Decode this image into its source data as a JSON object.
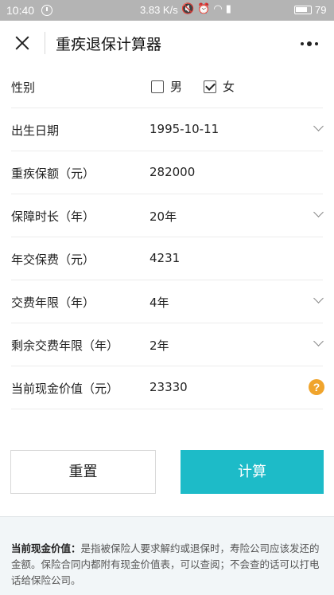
{
  "status_bar": {
    "time": "10:40",
    "speed": "3.83 K/s",
    "icons": [
      "mute-icon",
      "alarm-icon",
      "wifi-icon",
      "signal-icon"
    ],
    "battery": "79"
  },
  "nav": {
    "title": "重疾退保计算器"
  },
  "form": {
    "gender": {
      "label": "性别",
      "options": [
        {
          "label": "男",
          "checked": false
        },
        {
          "label": "女",
          "checked": true
        }
      ]
    },
    "birth_date": {
      "label": "出生日期",
      "value": "1995-10-11"
    },
    "coverage": {
      "label": "重疾保额（元）",
      "value": "282000"
    },
    "duration": {
      "label": "保障时长（年）",
      "value": "20年"
    },
    "annual_premium": {
      "label": "年交保费（元）",
      "value": "4231"
    },
    "pay_years": {
      "label": "交费年限（年）",
      "value": "4年"
    },
    "remaining_pay_years": {
      "label": "剩余交费年限（年）",
      "value": "2年"
    },
    "cash_value": {
      "label": "当前现金价值（元）",
      "value": "23330"
    }
  },
  "buttons": {
    "reset": "重置",
    "calculate": "计算"
  },
  "info": {
    "title": "当前现金价值：",
    "body": "是指被保险人要求解约或退保时，寿险公司应该发还的金额。保险合同内都附有现金价值表，可以查阅；不会查的话可以打电话给保险公司。"
  },
  "colors": {
    "accent": "#1dbbc8",
    "help_icon": "#f0a42c"
  }
}
